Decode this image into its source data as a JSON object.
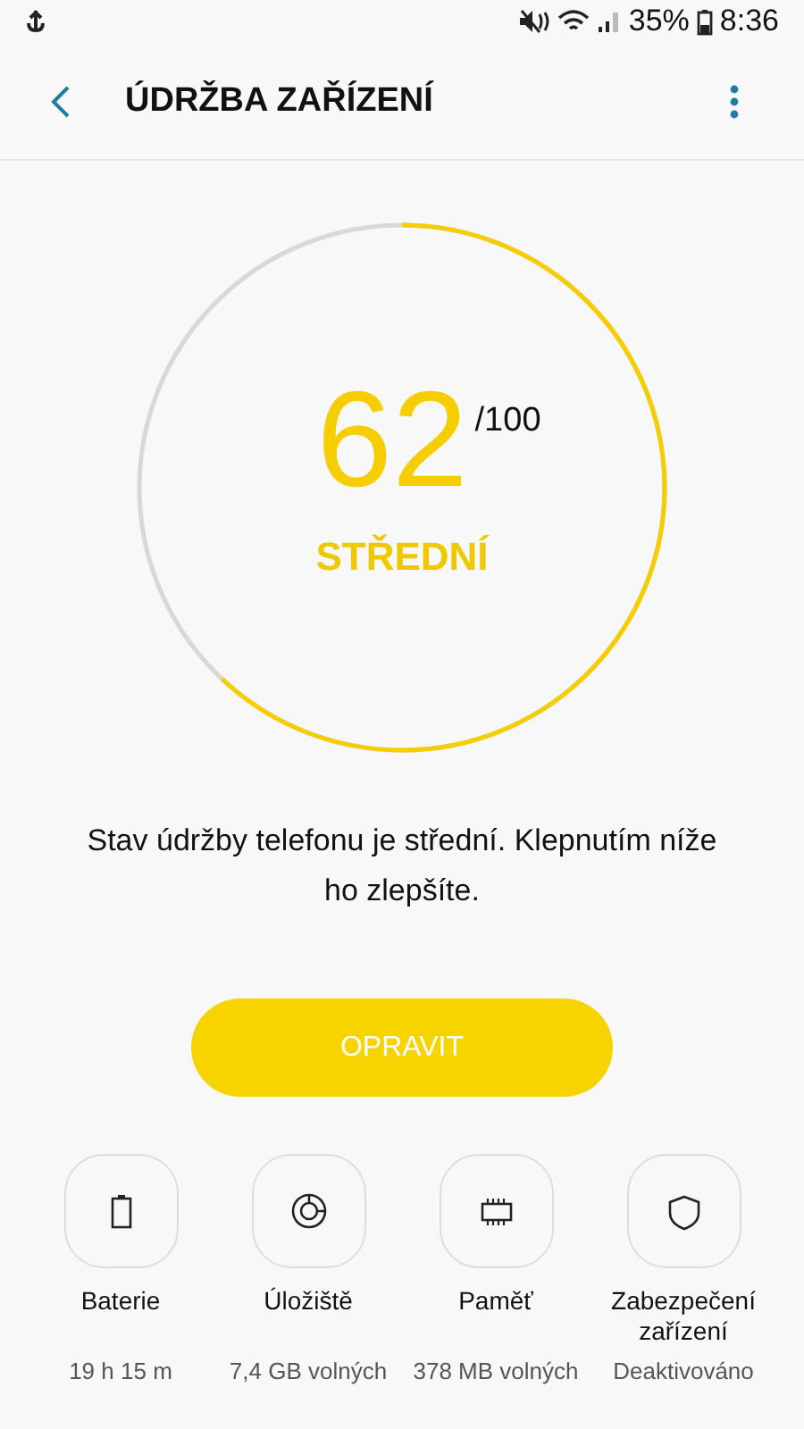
{
  "status_bar": {
    "battery_percent": "35%",
    "time": "8:36"
  },
  "app_bar": {
    "title": "ÚDRŽBA ZAŘÍZENÍ"
  },
  "score": {
    "value": "62",
    "max": "/100",
    "level": 0.62,
    "rating": "STŘEDNÍ"
  },
  "message": "Stav údržby telefonu je střední. Klepnutím níže ho zlepšíte.",
  "fix_button": {
    "label": "OPRAVIT"
  },
  "categories": [
    {
      "kind": "battery",
      "label": "Baterie",
      "detail": "19 h 15 m"
    },
    {
      "kind": "storage",
      "label": "Úložiště",
      "detail": "7,4 GB volných"
    },
    {
      "kind": "memory",
      "label": "Paměť",
      "detail": "378 MB volných"
    },
    {
      "kind": "security",
      "label": "Zabezpečení zařízení",
      "detail": "Deaktivováno"
    }
  ]
}
